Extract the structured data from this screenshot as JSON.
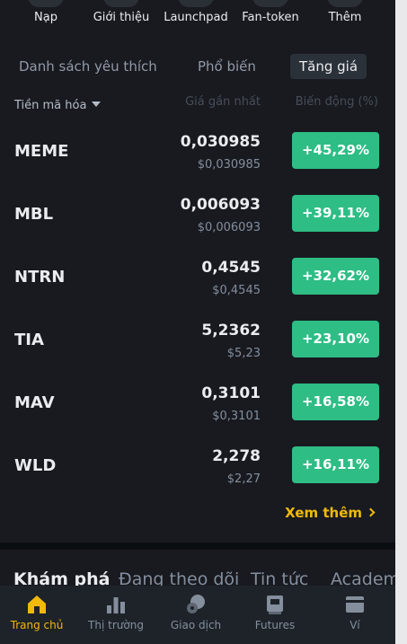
{
  "shortcuts": [
    {
      "label": "Nạp",
      "icon": "deposit-icon"
    },
    {
      "label": "Giới thiệu",
      "icon": "referral-icon"
    },
    {
      "label": "Launchpad",
      "icon": "launchpad-icon"
    },
    {
      "label": "Fan-token",
      "icon": "fan-token-icon"
    },
    {
      "label": "Thêm",
      "icon": "more-icon"
    }
  ],
  "tabs": {
    "favorites": "Danh sách yêu thích",
    "popular": "Phổ biến",
    "gainers": "Tăng giá"
  },
  "columns": {
    "name": "Tiền mã hóa",
    "price": "Giá gần nhất",
    "change": "Biến động (%)"
  },
  "rows": [
    {
      "symbol": "MEME",
      "price": "0,030985",
      "usd": "$0,030985",
      "change": "+45,29%"
    },
    {
      "symbol": "MBL",
      "price": "0,006093",
      "usd": "$0,006093",
      "change": "+39,11%"
    },
    {
      "symbol": "NTRN",
      "price": "0,4545",
      "usd": "$0,4545",
      "change": "+32,62%"
    },
    {
      "symbol": "TIA",
      "price": "5,2362",
      "usd": "$5,23",
      "change": "+23,10%"
    },
    {
      "symbol": "MAV",
      "price": "0,3101",
      "usd": "$0,3101",
      "change": "+16,58%"
    },
    {
      "symbol": "WLD",
      "price": "2,278",
      "usd": "$2,27",
      "change": "+16,11%"
    }
  ],
  "view_more": "Xem thêm",
  "explore_tabs": [
    "Khám phá",
    "Đang theo dõi",
    "Tin tức",
    "Academy"
  ],
  "bottom_nav": [
    {
      "label": "Trang chủ",
      "icon": "home-icon"
    },
    {
      "label": "Thị trường",
      "icon": "markets-icon"
    },
    {
      "label": "Giao dịch",
      "icon": "trade-icon"
    },
    {
      "label": "Futures",
      "icon": "futures-icon"
    },
    {
      "label": "Ví",
      "icon": "wallet-icon"
    }
  ],
  "colors": {
    "background": "#181a20",
    "positive": "#2ebd85",
    "accent": "#f0b90b",
    "nav_background": "#1e2329"
  }
}
